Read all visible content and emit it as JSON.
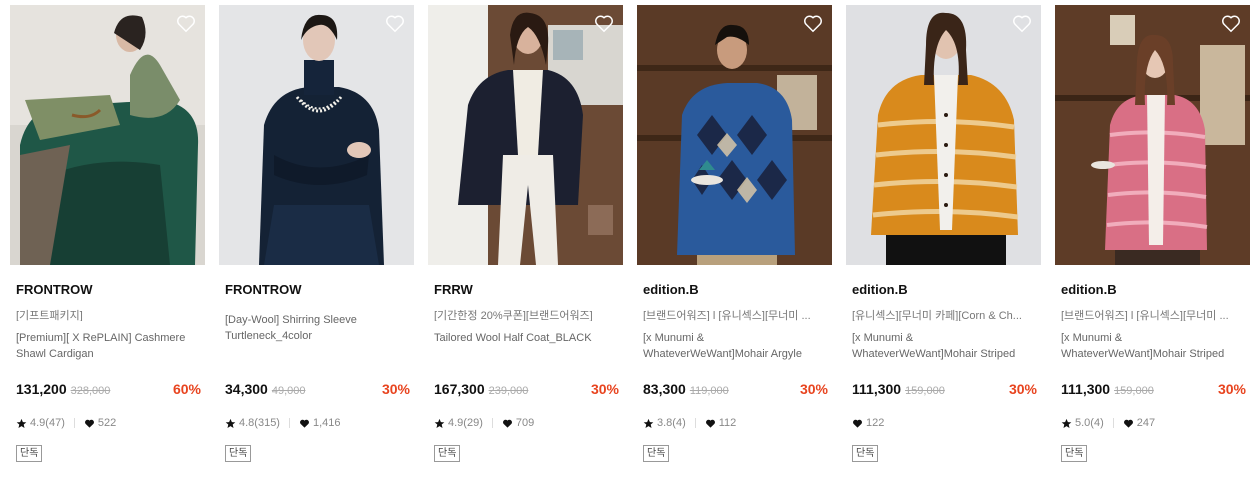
{
  "colors": {
    "discount": "#e8441f",
    "price": "#111111",
    "muted": "#888888"
  },
  "products": [
    {
      "brand": "FRONTROW",
      "tag": "[기프트패키지]",
      "title": "[Premium][ X RePLAIN] Cashmere Shawl Cardigan",
      "price": "131,200",
      "original_price": "328,000",
      "discount": "60%",
      "rating": "4.9(47)",
      "likes": "522",
      "badge": "단독",
      "image_icon": "photo-model-green-cardigan"
    },
    {
      "brand": "FRONTROW",
      "tag": "",
      "title": "[Day-Wool] Shirring Sleeve Turtleneck_4color",
      "price": "34,300",
      "original_price": "49,000",
      "discount": "30%",
      "rating": "4.8(315)",
      "likes": "1,416",
      "badge": "단독",
      "image_icon": "photo-model-navy-turtleneck"
    },
    {
      "brand": "FRRW",
      "tag": "[기간한정 20%쿠폰][브랜드어워즈]",
      "title": "Tailored Wool Half Coat_BLACK",
      "price": "167,300",
      "original_price": "239,000",
      "discount": "30%",
      "rating": "4.9(29)",
      "likes": "709",
      "badge": "단독",
      "image_icon": "photo-model-black-coat"
    },
    {
      "brand": "edition.B",
      "tag": "[브랜드어워즈] l [유니섹스][무너미 ...",
      "title": "[x Munumi & WhateverWeWant]Mohair Argyle Pullover(Mlik & Cooki...",
      "price": "83,300",
      "original_price": "119,000",
      "discount": "30%",
      "rating": "3.8(4)",
      "likes": "112",
      "badge": "단독",
      "image_icon": "photo-model-argyle-pullover"
    },
    {
      "brand": "edition.B",
      "tag": "[유니섹스][무너미 카페][Corn & Ch...",
      "title": "[x Munumi & WhateverWeWant]Mohair Striped Cardigan(Corn & Che...",
      "price": "111,300",
      "original_price": "159,000",
      "discount": "30%",
      "rating": "",
      "likes": "122",
      "badge": "단독",
      "image_icon": "photo-model-orange-cardigan"
    },
    {
      "brand": "edition.B",
      "tag": "[브랜드어워즈] l [유니섹스][무너미 ...",
      "title": "[x Munumi & WhateverWeWant]Mohair Striped Cardigan(Strawberry ...",
      "price": "111,300",
      "original_price": "159,000",
      "discount": "30%",
      "rating": "5.0(4)",
      "likes": "247",
      "badge": "단독",
      "image_icon": "photo-model-pink-cardigan"
    }
  ]
}
